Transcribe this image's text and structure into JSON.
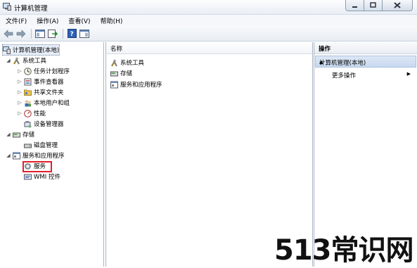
{
  "window": {
    "title": "计算机管理"
  },
  "menubar": {
    "items": [
      "文件(F)",
      "操作(A)",
      "查看(V)",
      "帮助(H)"
    ]
  },
  "tree": {
    "root": "计算机管理(本地)",
    "system_tools": "系统工具",
    "task_scheduler": "任务计划程序",
    "event_viewer": "事件查看器",
    "shared_folders": "共享文件夹",
    "local_users": "本地用户和组",
    "performance": "性能",
    "device_manager": "设备管理器",
    "storage": "存储",
    "disk_management": "磁盘管理",
    "services_apps": "服务和应用程序",
    "services": "服务",
    "wmi": "WMI 控件"
  },
  "middle": {
    "column_header": "名称",
    "items": [
      "系统工具",
      "存储",
      "服务和应用程序"
    ]
  },
  "actions": {
    "header": "操作",
    "selected": "计算机管理(本地)",
    "more": "更多操作"
  },
  "watermark": "513常识网"
}
